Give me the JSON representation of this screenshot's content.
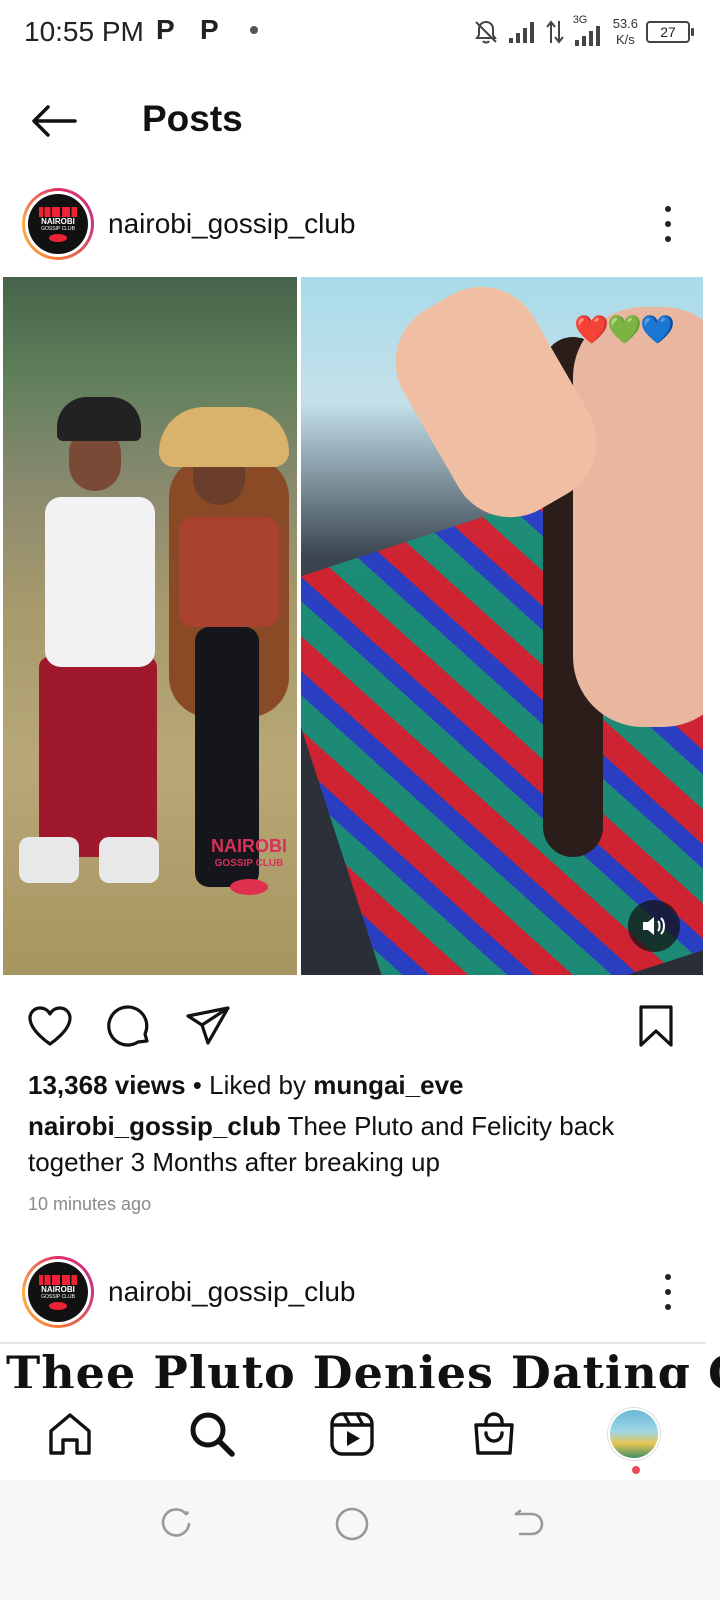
{
  "status_bar": {
    "time": "10:55 PM",
    "notif_p1": "P",
    "notif_p2": "P",
    "network_label": "3G",
    "speed_value": "53.6",
    "speed_unit": "K/s",
    "battery": "27"
  },
  "header": {
    "back_icon": "arrow-left-icon",
    "title": "Posts"
  },
  "post": {
    "username": "nairobi_gossip_club",
    "avatar_text": "NAIROBI",
    "avatar_sub": "GOSSIP CLUB",
    "watermark_text": "NAIROBI",
    "watermark_sub": "GOSSIP CLUB",
    "emojis": "❤️💚💙",
    "views": "13,368 views",
    "liked_prefix": " • Liked by ",
    "liked_by": "mungai_eve",
    "caption_user": "nairobi_gossip_club",
    "caption_text": " Thee Pluto and Felicity back together 3 Months after breaking up",
    "timestamp": "10 minutes ago"
  },
  "next_post": {
    "username": "nairobi_gossip_club",
    "avatar_text": "NAIROBI",
    "avatar_sub": "GOSSIP CLUB",
    "headline_preview": "Thee Pluto Denies Dating City"
  },
  "icons": {
    "like": "heart-icon",
    "comment": "comment-icon",
    "share": "send-icon",
    "save": "bookmark-icon",
    "volume": "volume-icon",
    "home": "home-icon",
    "search": "search-icon",
    "reels": "reels-icon",
    "shop": "shop-icon"
  },
  "colors": {
    "accent": "#ed4956",
    "text": "#111111",
    "muted": "#8a8a8a"
  }
}
